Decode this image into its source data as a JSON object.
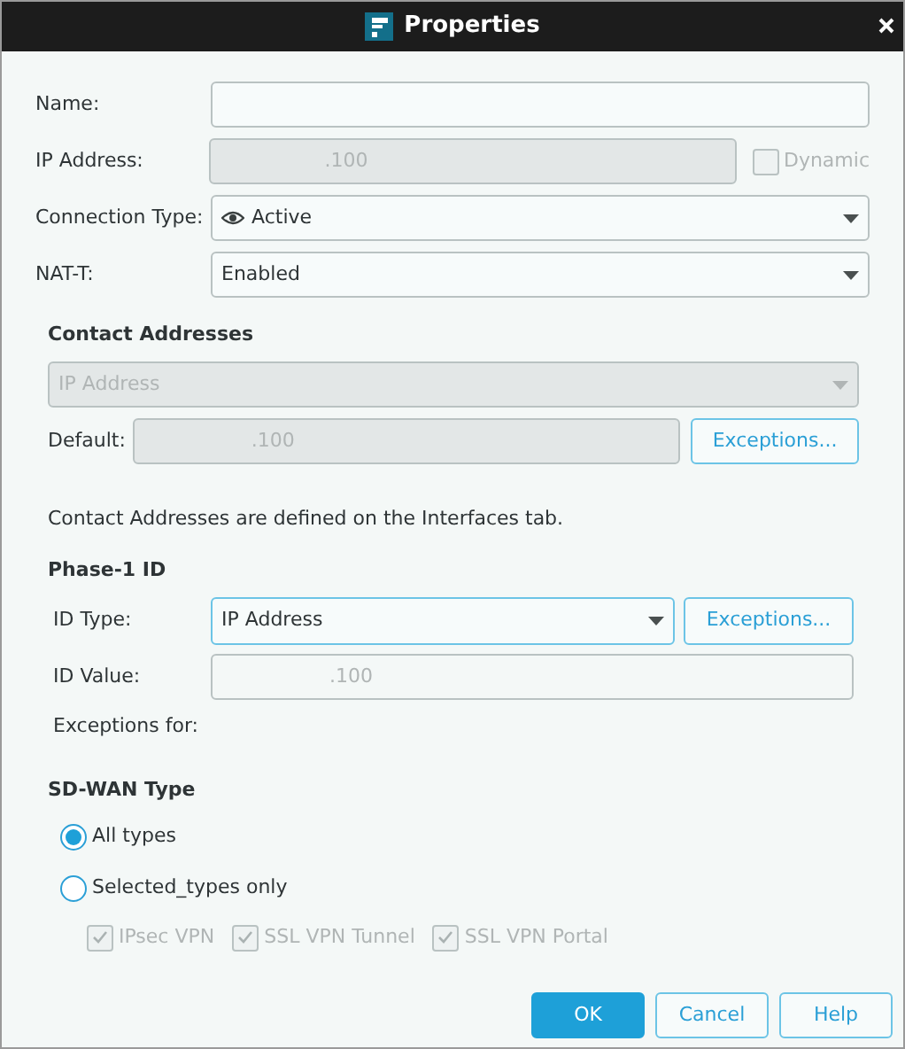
{
  "window": {
    "title": "Properties"
  },
  "fields": [
    {
      "kind": "text",
      "label": "Name:",
      "disabled": false
    },
    {
      "kind": "text",
      "label": "IP Address:",
      "value": ".100",
      "disabled": true,
      "checkbox": {
        "label": "Dynamic",
        "checked": false,
        "disabled": true
      }
    },
    {
      "kind": "dropdown",
      "label": "Connection Type:",
      "value": "Active",
      "icon": true
    },
    {
      "kind": "dropdown",
      "label": "NAT-T:",
      "value": "Enabled"
    }
  ],
  "contact_addresses": {
    "heading": "Contact Addresses",
    "dropdown": {
      "value": "IP Address",
      "disabled": true
    },
    "default_label": "Default:",
    "default_value": ".100",
    "exceptions_button": "Exceptions...",
    "note": "Contact Addresses are defined on the Interfaces tab."
  },
  "phase1": {
    "heading": "Phase-1 ID",
    "id_type_label": "ID Type:",
    "id_type_value": "IP Address",
    "exceptions_button": "Exceptions...",
    "id_value_label": "ID Value:",
    "id_value": ".100",
    "exceptions_for": "Exceptions for:"
  },
  "sdwan": {
    "heading": "SD-WAN Type",
    "options": [
      {
        "label": "All types",
        "selected": true
      },
      {
        "label": "Selected_types only",
        "selected": false
      }
    ],
    "types": [
      {
        "label": "IPsec VPN",
        "checked": true,
        "disabled": true
      },
      {
        "label": "SSL VPN Tunnel",
        "checked": true,
        "disabled": true
      },
      {
        "label": "SSL VPN Portal",
        "checked": true,
        "disabled": true
      }
    ]
  },
  "buttons": [
    {
      "label": "OK",
      "kind": "primary"
    },
    {
      "label": "Cancel",
      "kind": "secondary"
    },
    {
      "label": "Help",
      "kind": "secondary"
    }
  ]
}
